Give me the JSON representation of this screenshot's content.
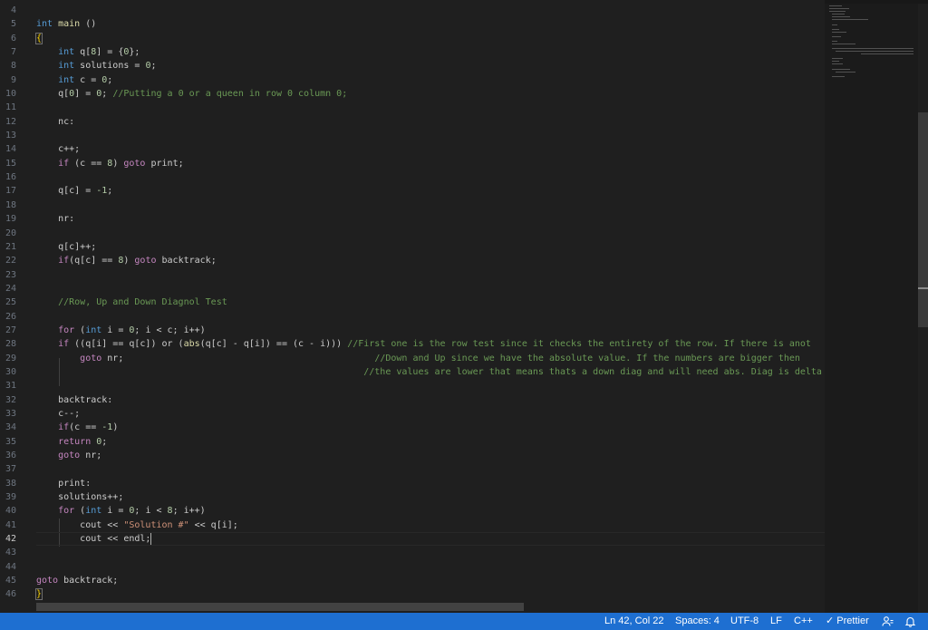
{
  "editor": {
    "active_line": "42",
    "line_numbers": [
      "4",
      "5",
      "6",
      "7",
      "8",
      "9",
      "10",
      "11",
      "12",
      "13",
      "14",
      "15",
      "16",
      "17",
      "18",
      "19",
      "20",
      "21",
      "22",
      "23",
      "24",
      "25",
      "26",
      "27",
      "28",
      "29",
      "30",
      "31",
      "32",
      "33",
      "34",
      "35",
      "36",
      "37",
      "38",
      "39",
      "40",
      "41",
      "42",
      "43",
      "44",
      "45",
      "46"
    ]
  },
  "code": {
    "l5_int": "int",
    "l5_main": "main",
    "l5_paren": " ()",
    "l6_brace": "{",
    "l7": [
      "int",
      " q[",
      "8",
      "] = {",
      "0",
      "};"
    ],
    "l8": [
      "int",
      " solutions = ",
      "0",
      ";"
    ],
    "l9": [
      "int",
      " c = ",
      "0",
      ";"
    ],
    "l10": [
      "q[",
      "0",
      "] = ",
      "0",
      "; ",
      "//Putting a 0 or a queen in row 0 column 0;"
    ],
    "l12": "nc:",
    "l14": "c++;",
    "l15": [
      "if",
      " (c == ",
      "8",
      ") ",
      "goto",
      " print;"
    ],
    "l17": [
      "q[c] = ",
      "-1",
      ";"
    ],
    "l19": "nr:",
    "l21": "q[c]++;",
    "l22": [
      "if",
      "(q[c] == ",
      "8",
      ") ",
      "goto",
      " backtrack;"
    ],
    "l25": "//Row, Up and Down Diagnol Test",
    "l27": [
      "for",
      " (",
      "int",
      " i = ",
      "0",
      "; i < c; i++)"
    ],
    "l28": [
      "if",
      " ((q[i] == q[c]) or (",
      "abs",
      "(q[c] - q[i]) == (c - i))) ",
      "//First one is the row test since it checks the entirety of the row. If there is anot"
    ],
    "l29": [
      "goto",
      " nr;",
      "//Down and Up since we have the absolute value. If the numbers are bigger then"
    ],
    "l30": "//the values are lower that means thats a down diag and will need abs. Diag is delta x",
    "l32": "backtrack:",
    "l33": "c--;",
    "l34": [
      "if",
      "(c == ",
      "-1",
      ")"
    ],
    "l35": [
      "return",
      " ",
      "0",
      ";"
    ],
    "l36": [
      "goto",
      " nr;"
    ],
    "l38": "print:",
    "l39": "solutions++;",
    "l40": [
      "for",
      " (",
      "int",
      " i = ",
      "0",
      "; i < ",
      "8",
      "; i++)"
    ],
    "l41": [
      "cout << ",
      "\"Solution #\"",
      " << q[i];"
    ],
    "l42": "cout << endl;",
    "l45": [
      "goto",
      " backtrack;"
    ],
    "l46_brace": "}"
  },
  "statusbar": {
    "position": "Ln 42, Col 22",
    "spaces": "Spaces: 4",
    "encoding": "UTF-8",
    "eol": "LF",
    "language": "C++",
    "formatter": "Prettier",
    "color": "#1e6fd1"
  }
}
